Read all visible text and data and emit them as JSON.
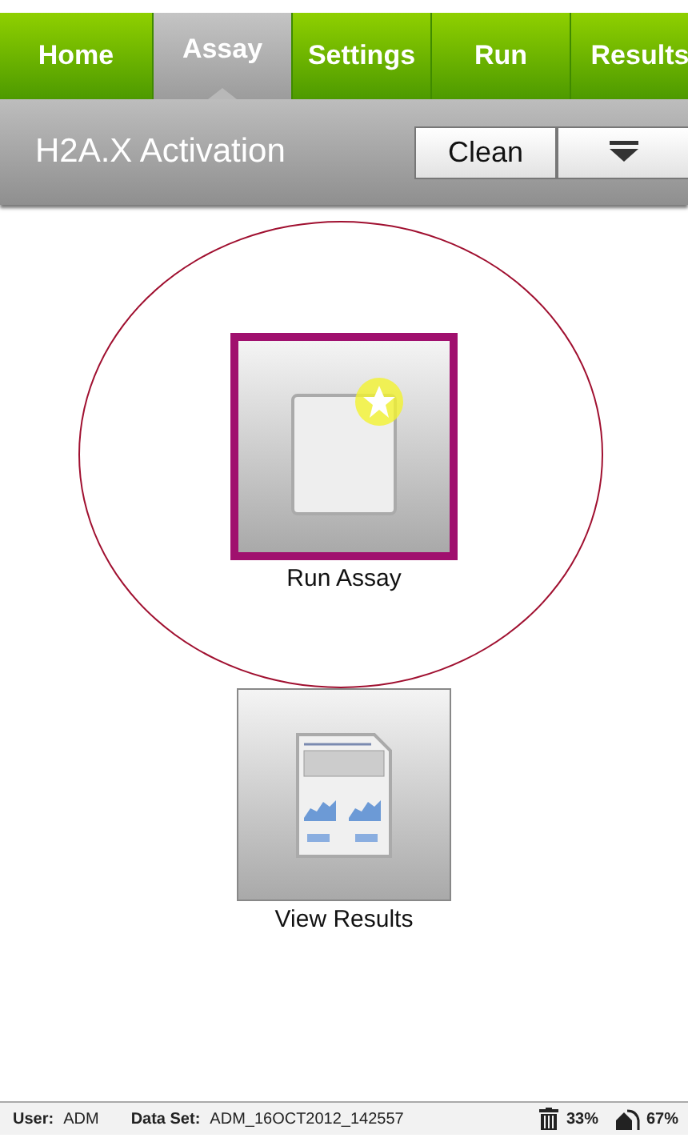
{
  "tabs": [
    {
      "label": "Home",
      "selected": false
    },
    {
      "label": "Assay",
      "selected": true
    },
    {
      "label": "Settings",
      "selected": false
    },
    {
      "label": "Run",
      "selected": false
    },
    {
      "label": "Results",
      "selected": false
    }
  ],
  "header": {
    "title": "H2A.X Activation",
    "buttons": [
      {
        "kind": "text",
        "label": "Clean"
      },
      {
        "kind": "menu"
      }
    ]
  },
  "tiles": [
    {
      "kind": "new",
      "label": "Run Assay",
      "selected": true,
      "circled": true
    },
    {
      "kind": "results",
      "label": "View Results",
      "selected": false,
      "circled": false
    }
  ],
  "status_bar": {
    "user_label": "User:",
    "user": "ADM",
    "dataset_label": "Data Set:",
    "dataset": "ADM_16OCT2012_142557",
    "trash": "33%",
    "storage": "67%"
  }
}
